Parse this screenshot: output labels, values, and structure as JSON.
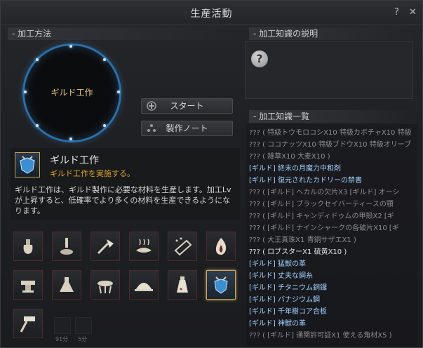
{
  "window": {
    "title": "生産活動",
    "help_label": "?",
    "close_label": "✕"
  },
  "method": {
    "header": "- 加工方法",
    "circle_label": "ギルド工作",
    "start_label": "スタート",
    "note_label": "製作ノート"
  },
  "info": {
    "name": "ギルド工作",
    "subtitle": "ギルド工作を実施する。",
    "description": "ギルド工作は、ギルド製作に必要な材料を生産します。加工Lvが上昇すると、低確率でより多くの材料を生産できるようになります。"
  },
  "knowledge_desc": {
    "header": "- 加工知識の説明",
    "placeholder_icon": "?"
  },
  "knowledge_list": {
    "header": "- 加工知識一覧",
    "items": [
      {
        "text": "??? ( 特級トウモロコシX10 特級カボチャX10 特級",
        "state": "unknown"
      },
      {
        "text": "??? ( ココナッツX10 特級ブドウX10 特級オリーブ",
        "state": "unknown"
      },
      {
        "text": "??? ( 雑草X10 大麦X10 )",
        "state": "unknown"
      },
      {
        "text": "[ギルド] 終末の月魔力中和剤",
        "state": "known"
      },
      {
        "text": "[ギルド] 復元されたカドリーの禁書",
        "state": "known"
      },
      {
        "text": "??? ( [ギルド] ヘカルの欠片X3 [ギルド] オーシ",
        "state": "unknown"
      },
      {
        "text": "??? ( [ギルド] ブラックセイバーティースの顎",
        "state": "unknown"
      },
      {
        "text": "??? ( [ギルド] キャンディドゥムの甲殻X2 [ギ",
        "state": "unknown"
      },
      {
        "text": "??? ( [ギルド] ナインシャークの各破片X10 [ギ",
        "state": "unknown"
      },
      {
        "text": "??? ( 大王真珠X1 青銅サザエX1 )",
        "state": "unknown"
      },
      {
        "text": "??? ( ロブスターX1 硫黄X10 )",
        "state": "bright"
      },
      {
        "text": "[ギルド] 猛獣の革",
        "state": "known"
      },
      {
        "text": "[ギルド] 丈夫な綱糸",
        "state": "known"
      },
      {
        "text": "[ギルド] チタニウム銅鑼",
        "state": "known"
      },
      {
        "text": "[ギルド] バナジウム鋼",
        "state": "known"
      },
      {
        "text": "[ギルド] 千年樹コア合板",
        "state": "known"
      },
      {
        "text": "[ギルド] 神獣の革",
        "state": "known"
      },
      {
        "text": "??? ( [ギルド] 通関許可証X1 使える角材X5 )",
        "state": "unknown"
      }
    ]
  },
  "icons": {
    "row1": [
      "shaking-icon",
      "grinding-icon",
      "chopping-icon",
      "drying-icon",
      "filtering-icon",
      "heating-icon"
    ],
    "row2": [
      "smithing-icon",
      "alchemy-icon",
      "cooking-icon",
      "serving-icon",
      "alchemy-flask-icon",
      "guild-crafting-icon"
    ],
    "row3": [
      "hammer-icon"
    ],
    "small_slots": [
      {
        "name": "locked-slot-1-icon",
        "caption": "91分"
      },
      {
        "name": "locked-slot-2-icon",
        "caption": "5分"
      }
    ]
  },
  "colors": {
    "accent_gold": "#e0a72a",
    "circle_glow": "#2b6fa8",
    "known_item": "#9fd0ff",
    "unknown_item": "#8d8d8d"
  }
}
